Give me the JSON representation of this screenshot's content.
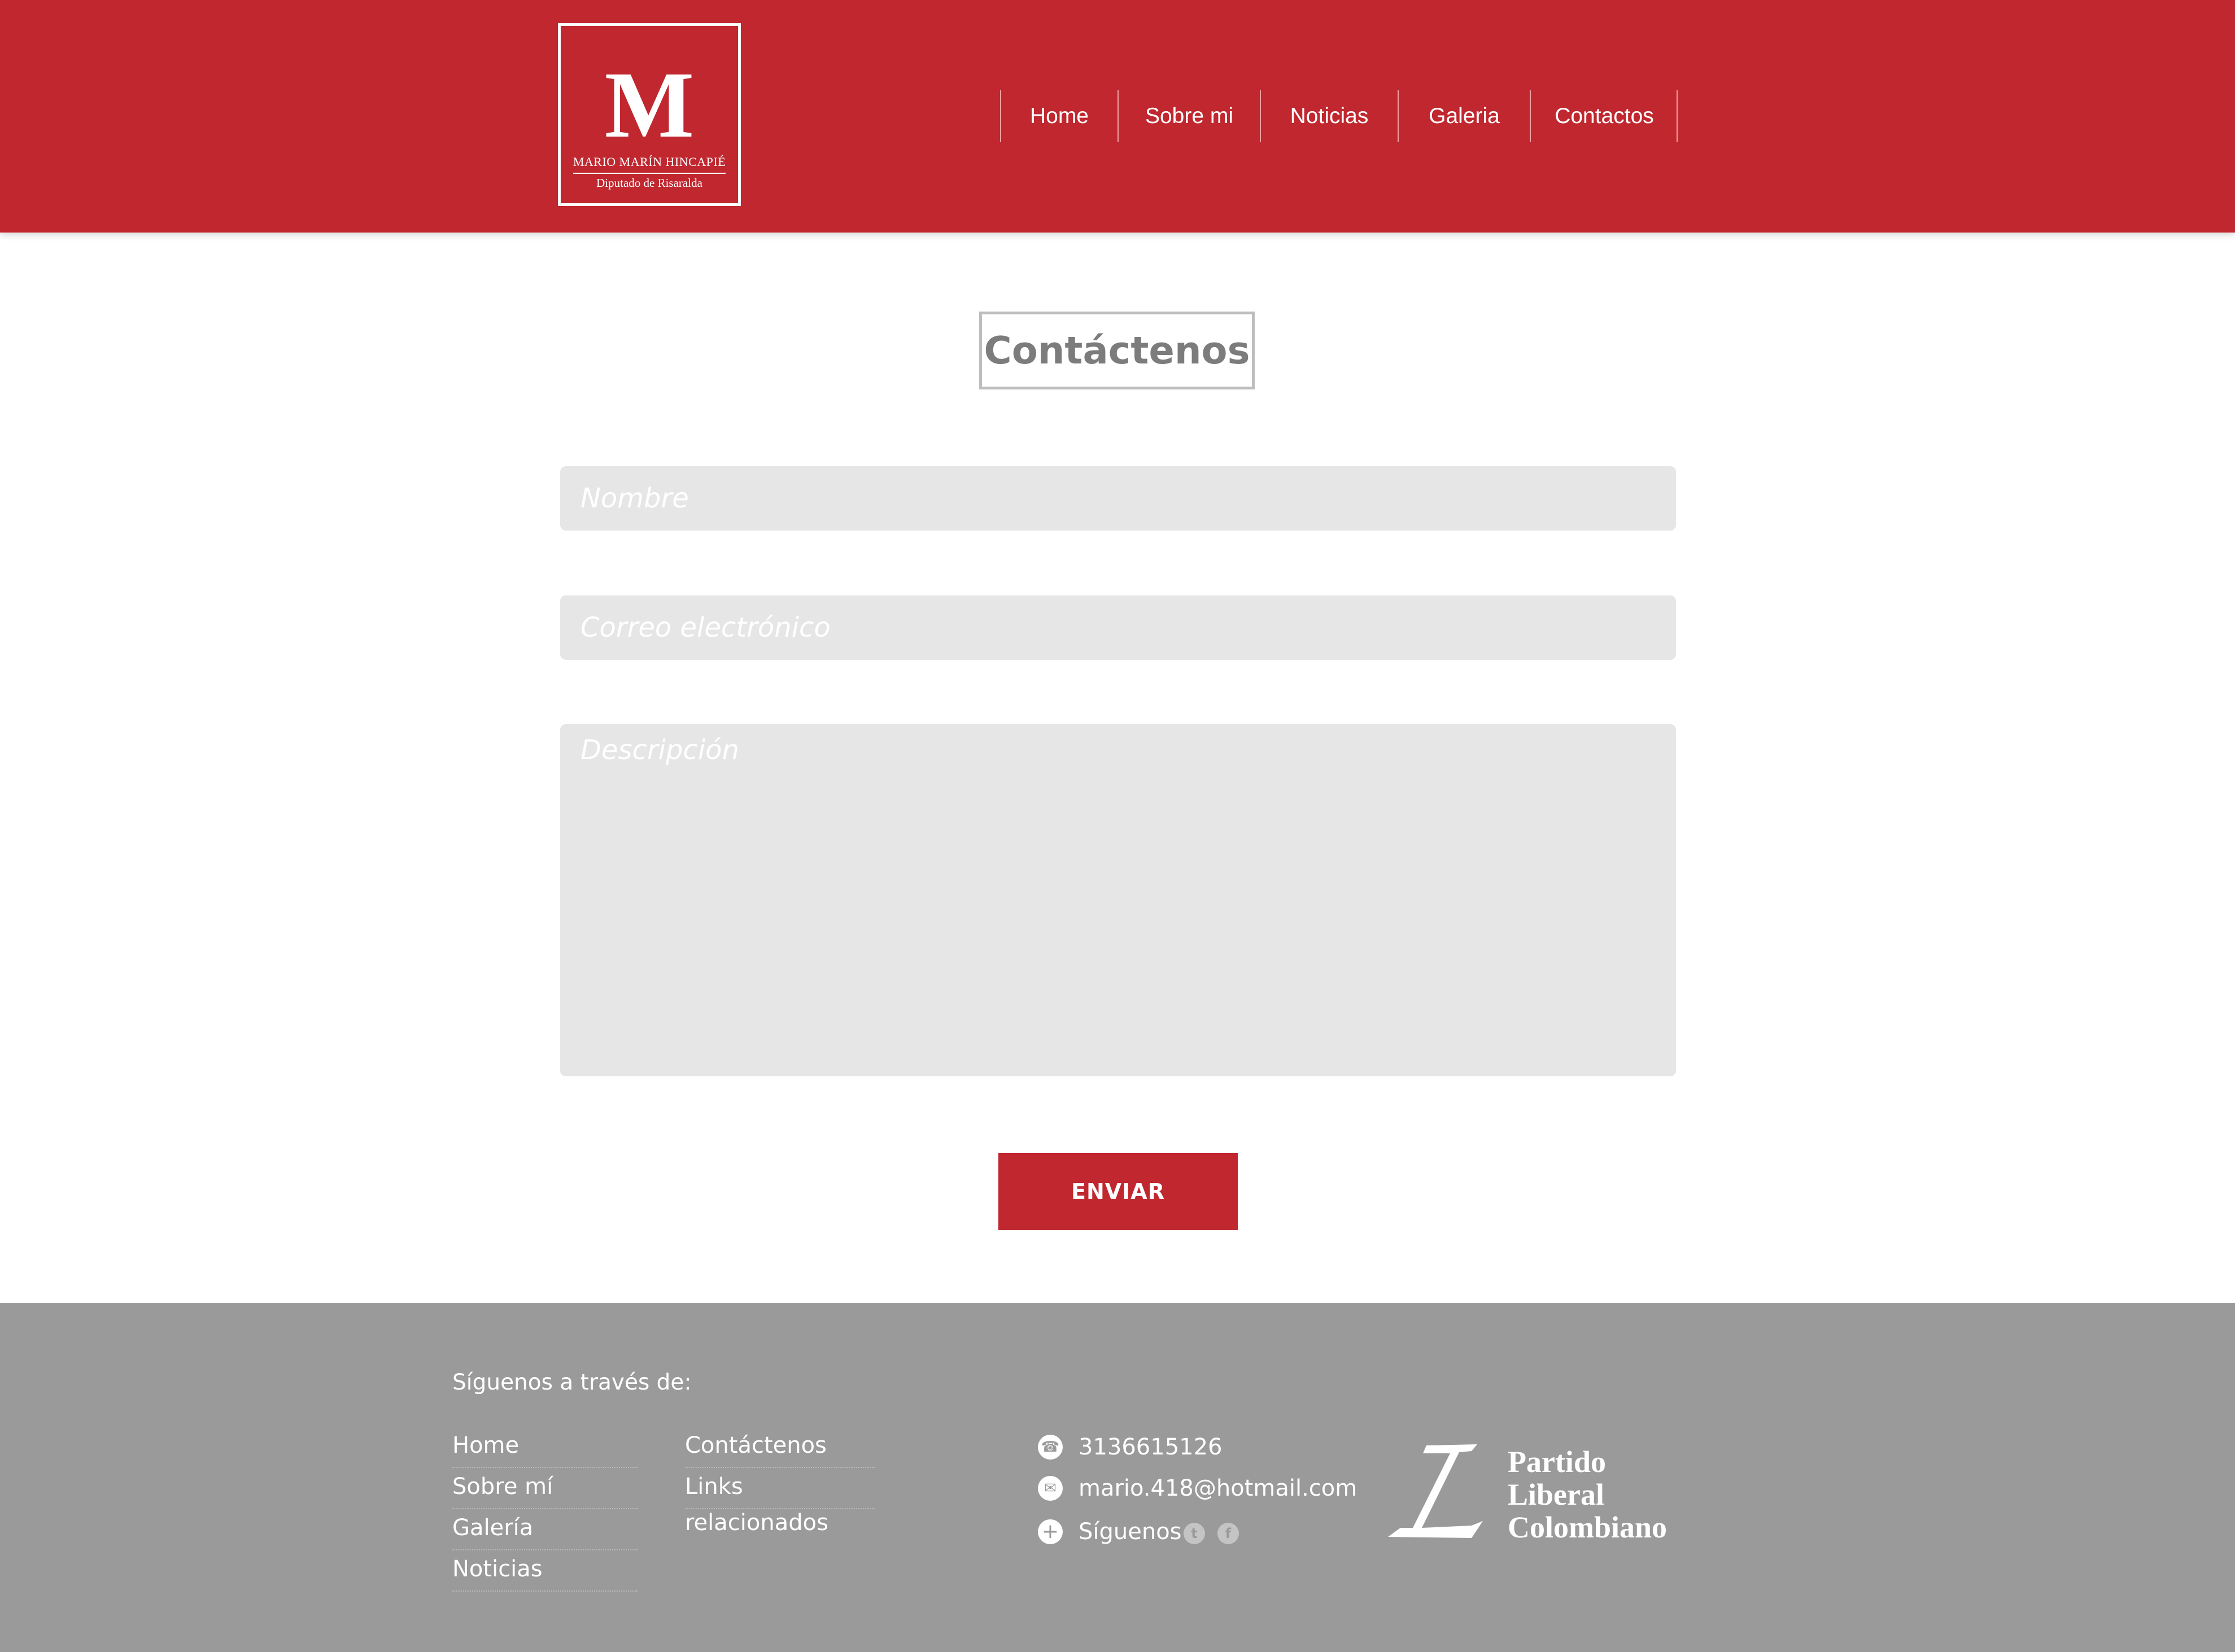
{
  "brand": {
    "initial": "M",
    "name": "MARIO MARÍN HINCAPIÉ",
    "subtitle": "Diputado de Risaralda"
  },
  "nav": {
    "items": [
      {
        "label": "Home"
      },
      {
        "label": "Sobre mi"
      },
      {
        "label": "Noticias"
      },
      {
        "label": "Galeria"
      },
      {
        "label": "Contactos"
      }
    ]
  },
  "contact": {
    "title": "Contáctenos",
    "name_placeholder": "Nombre",
    "email_placeholder": "Correo electrónico",
    "description_placeholder": "Descripción",
    "submit_label": "ENVIAR"
  },
  "footer": {
    "heading": "Síguenos a través de:",
    "links_col1": [
      "Home",
      "Sobre mí",
      "Galería",
      "Noticias"
    ],
    "links_col2": [
      "Contáctenos",
      "Links relacionados"
    ],
    "phone": "3136615126",
    "email": "mario.418@hotmail.com",
    "follow_label": "Síguenos",
    "social_icons": [
      "twitter-icon",
      "facebook-icon"
    ],
    "party_logo": {
      "mark": "L",
      "lines": [
        "Partido",
        "Liberal",
        "Colombiano"
      ]
    }
  },
  "colors": {
    "brand_red": "#c0272f",
    "footer_gray": "#9a9a9a",
    "field_gray": "#e6e6e6"
  }
}
